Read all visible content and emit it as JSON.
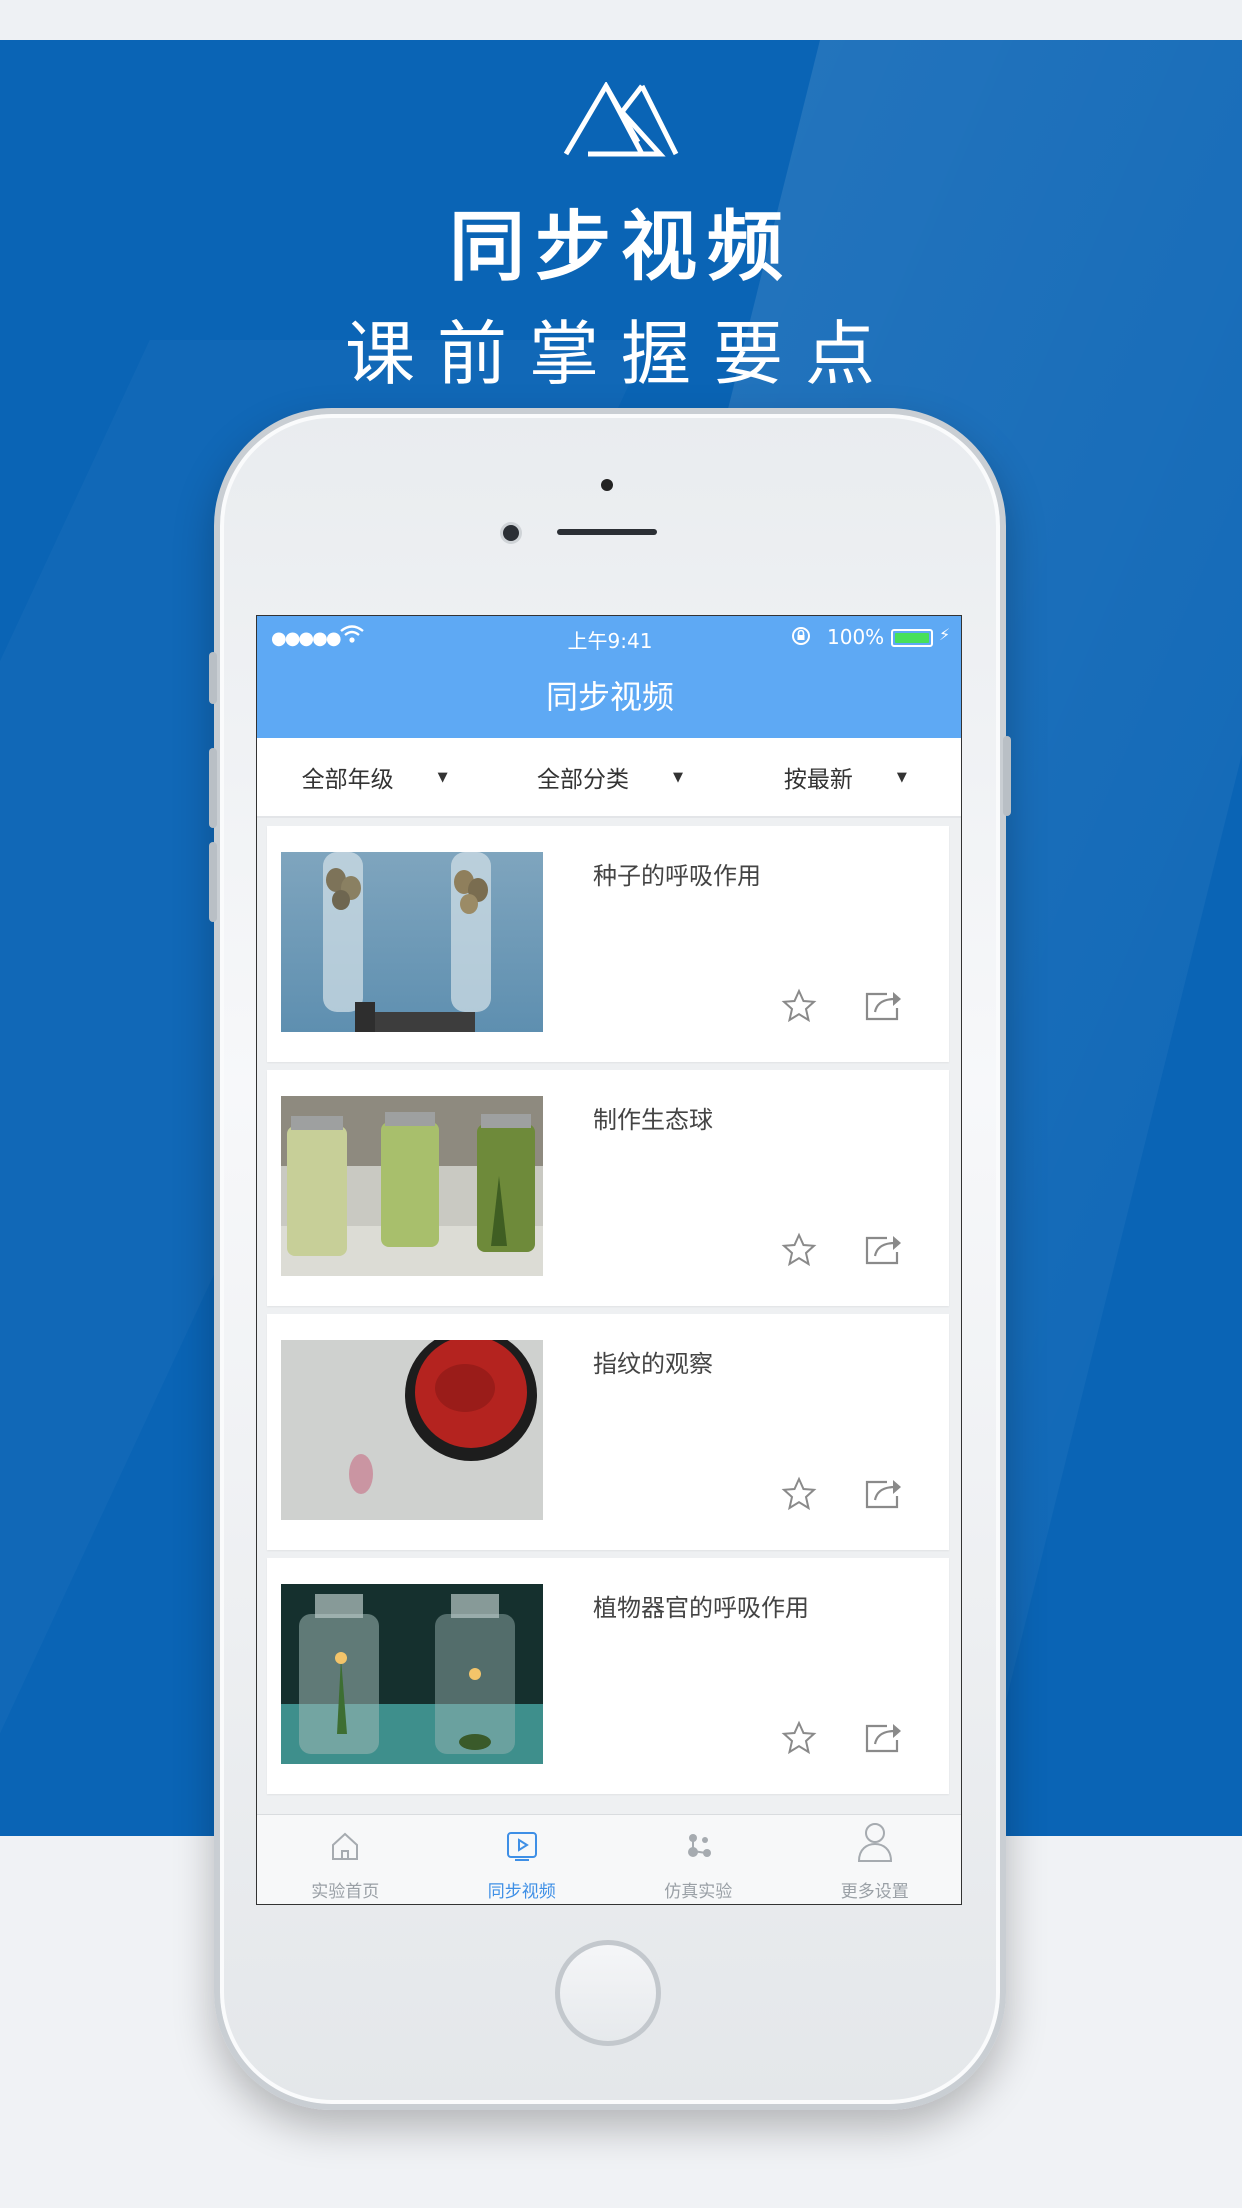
{
  "poster": {
    "headline": "同步视频",
    "subline": "课前掌握要点",
    "logo_icon": "triangle-logo-icon",
    "colors": {
      "background": "#0a64b5",
      "text": "#ffffff"
    }
  },
  "status_bar": {
    "signal": "●●●●●",
    "time": "上午9:41",
    "battery_percent": "100%",
    "battery_level": 1.0,
    "wifi_icon": "wifi-icon",
    "lock_icon": "rotation-lock-icon",
    "charging_icon": "bolt-icon"
  },
  "app": {
    "title": "同步视频",
    "accent": "#5ea9f4",
    "filters": [
      {
        "label": "全部年级",
        "icon": "caret-down-icon"
      },
      {
        "label": "全部分类",
        "icon": "caret-down-icon"
      },
      {
        "label": "按最新",
        "icon": "caret-down-icon"
      }
    ],
    "videos": [
      {
        "title": "种子的呼吸作用",
        "thumbnail": "test-tubes-with-seeds"
      },
      {
        "title": "制作生态球",
        "thumbnail": "jars-with-water-plants"
      },
      {
        "title": "指纹的观察",
        "thumbnail": "ink-pad-and-fingerprint"
      },
      {
        "title": "植物器官的呼吸作用",
        "thumbnail": "bottles-with-candle"
      }
    ],
    "card_icons": {
      "favorite": "star-icon",
      "share": "share-icon"
    },
    "tabs": [
      {
        "label": "实验首页",
        "icon": "home-icon",
        "active": false
      },
      {
        "label": "同步视频",
        "icon": "play-icon",
        "active": true
      },
      {
        "label": "仿真实验",
        "icon": "molecule-icon",
        "active": false
      },
      {
        "label": "更多设置",
        "icon": "user-icon",
        "active": false
      }
    ]
  }
}
